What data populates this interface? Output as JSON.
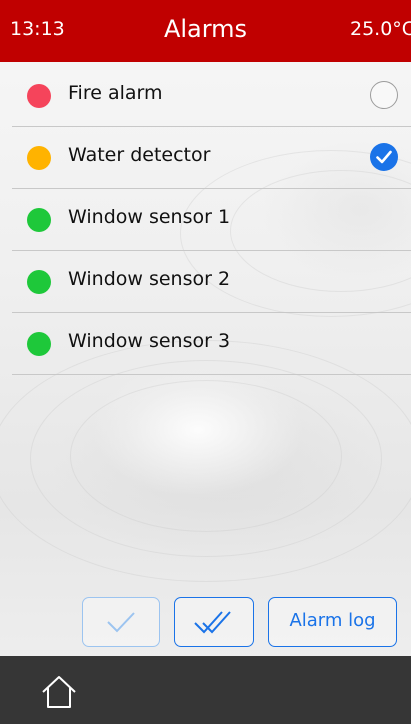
{
  "header": {
    "time": "13:13",
    "title": "Alarms",
    "temperature": "25.0°C"
  },
  "alarms": [
    {
      "label": "Fire alarm",
      "status_color": "#f5445b",
      "checked": false
    },
    {
      "label": "Water detector",
      "status_color": "#ffb300",
      "checked": true
    },
    {
      "label": "Window sensor 1",
      "status_color": "#1ec83a",
      "checked": null
    },
    {
      "label": "Window sensor 2",
      "status_color": "#1ec83a",
      "checked": null
    },
    {
      "label": "Window sensor 3",
      "status_color": "#1ec83a",
      "checked": null
    }
  ],
  "buttons": {
    "acknowledge_icon": "check-icon",
    "acknowledge_all_icon": "double-check-icon",
    "alarm_log_label": "Alarm log"
  },
  "footer": {
    "home_icon": "home-icon"
  },
  "colors": {
    "header_bg": "#c00000",
    "accent": "#1a73e8",
    "footer_bg": "#363636"
  }
}
